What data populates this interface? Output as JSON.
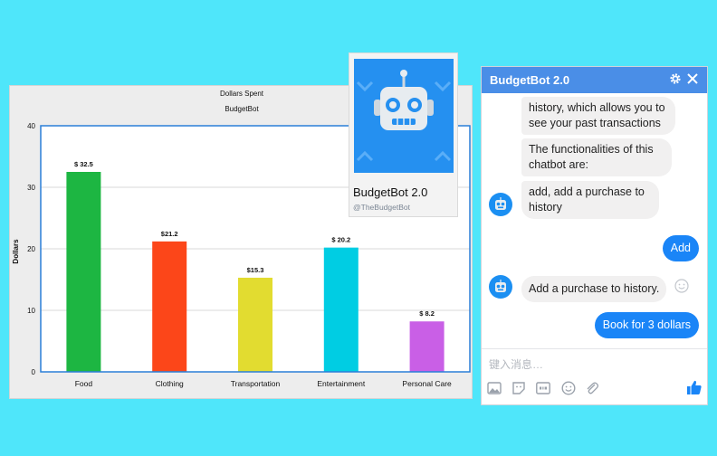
{
  "chart_data": {
    "type": "bar",
    "title": "Dollars Spent",
    "subtitle": "BudgetBot",
    "xlabel": "",
    "ylabel": "Dollars",
    "categories": [
      "Food",
      "Clothing",
      "Transportation",
      "Entertainment",
      "Personal Care"
    ],
    "values": [
      32.5,
      21.2,
      15.3,
      20.2,
      8.2
    ],
    "value_labels": [
      "$ 32.5",
      "$21.2",
      "$15.3",
      "$ 20.2",
      "$ 8.2"
    ],
    "colors": [
      "#1db642",
      "#fc4619",
      "#e2dc30",
      "#00cde3",
      "#c95fe6"
    ],
    "ylim": [
      0,
      40
    ],
    "yticks": [
      "0",
      "10",
      "20",
      "30",
      "40"
    ],
    "grid": true,
    "legend": "none"
  },
  "bot_card": {
    "name": "BudgetBot 2.0",
    "handle": "@TheBudgetBot",
    "avatar_icon": "robot-icon"
  },
  "messenger": {
    "title": "BudgetBot 2.0",
    "header_color": "#4a8ee7",
    "gear_icon": "gear-icon",
    "close_icon": "close-icon",
    "messages": [
      {
        "from": "bot",
        "text": "history, which allows you to see your past transactions"
      },
      {
        "from": "bot",
        "text": "The functionalities of this chatbot are:"
      },
      {
        "from": "bot",
        "text": "add, add a purchase to history"
      },
      {
        "from": "user",
        "text": "Add"
      },
      {
        "from": "bot",
        "text": "Add a purchase to history."
      },
      {
        "from": "user",
        "text": "Book for 3 dollars"
      }
    ],
    "input_placeholder": "键入消息…",
    "tools": [
      "image-icon",
      "sticker-icon",
      "gif-icon",
      "emoji-icon",
      "attachment-icon",
      "like-icon"
    ]
  }
}
